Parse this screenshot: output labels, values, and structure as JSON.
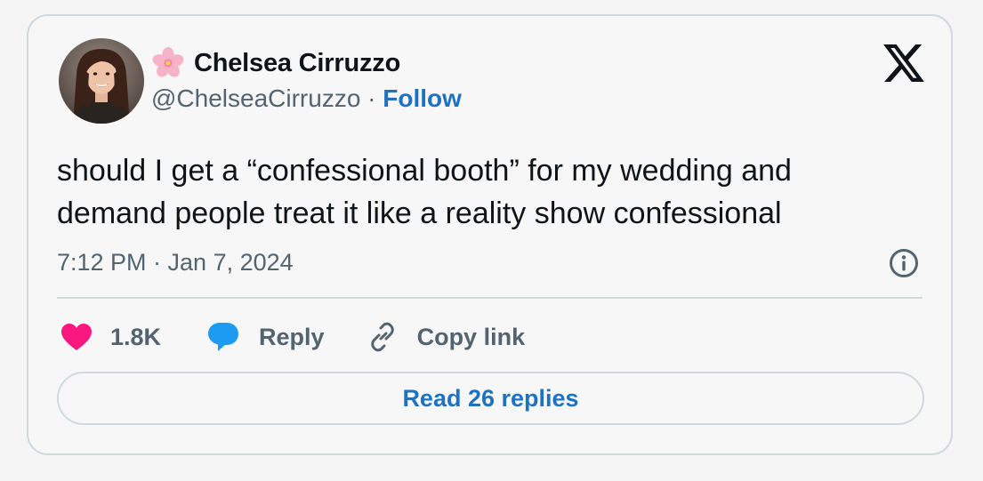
{
  "author": {
    "emoji_icon": "cherry-blossom-icon",
    "name": "Chelsea Cirruzzo",
    "handle": "@ChelseaCirruzzo",
    "separator": "·",
    "follow_label": "Follow"
  },
  "brand": {
    "logo_icon": "x-logo-icon"
  },
  "tweet": {
    "text_line1": "should I get a “confessional booth” for my wedding and",
    "text_line2": "demand people treat it like a reality show confessional",
    "timestamp": "7:12 PM · Jan 7, 2024",
    "info_icon": "info-icon"
  },
  "actions": {
    "like_count": "1.8K",
    "reply_label": "Reply",
    "copy_link_label": "Copy link"
  },
  "footer": {
    "read_replies_label": "Read 26 replies"
  },
  "colors": {
    "text": "#0f1419",
    "secondary": "#536471",
    "link_blue": "#1d73c2",
    "heart": "#f91880",
    "reply_bubble": "#1d9bf0",
    "border": "#cfd9de"
  }
}
